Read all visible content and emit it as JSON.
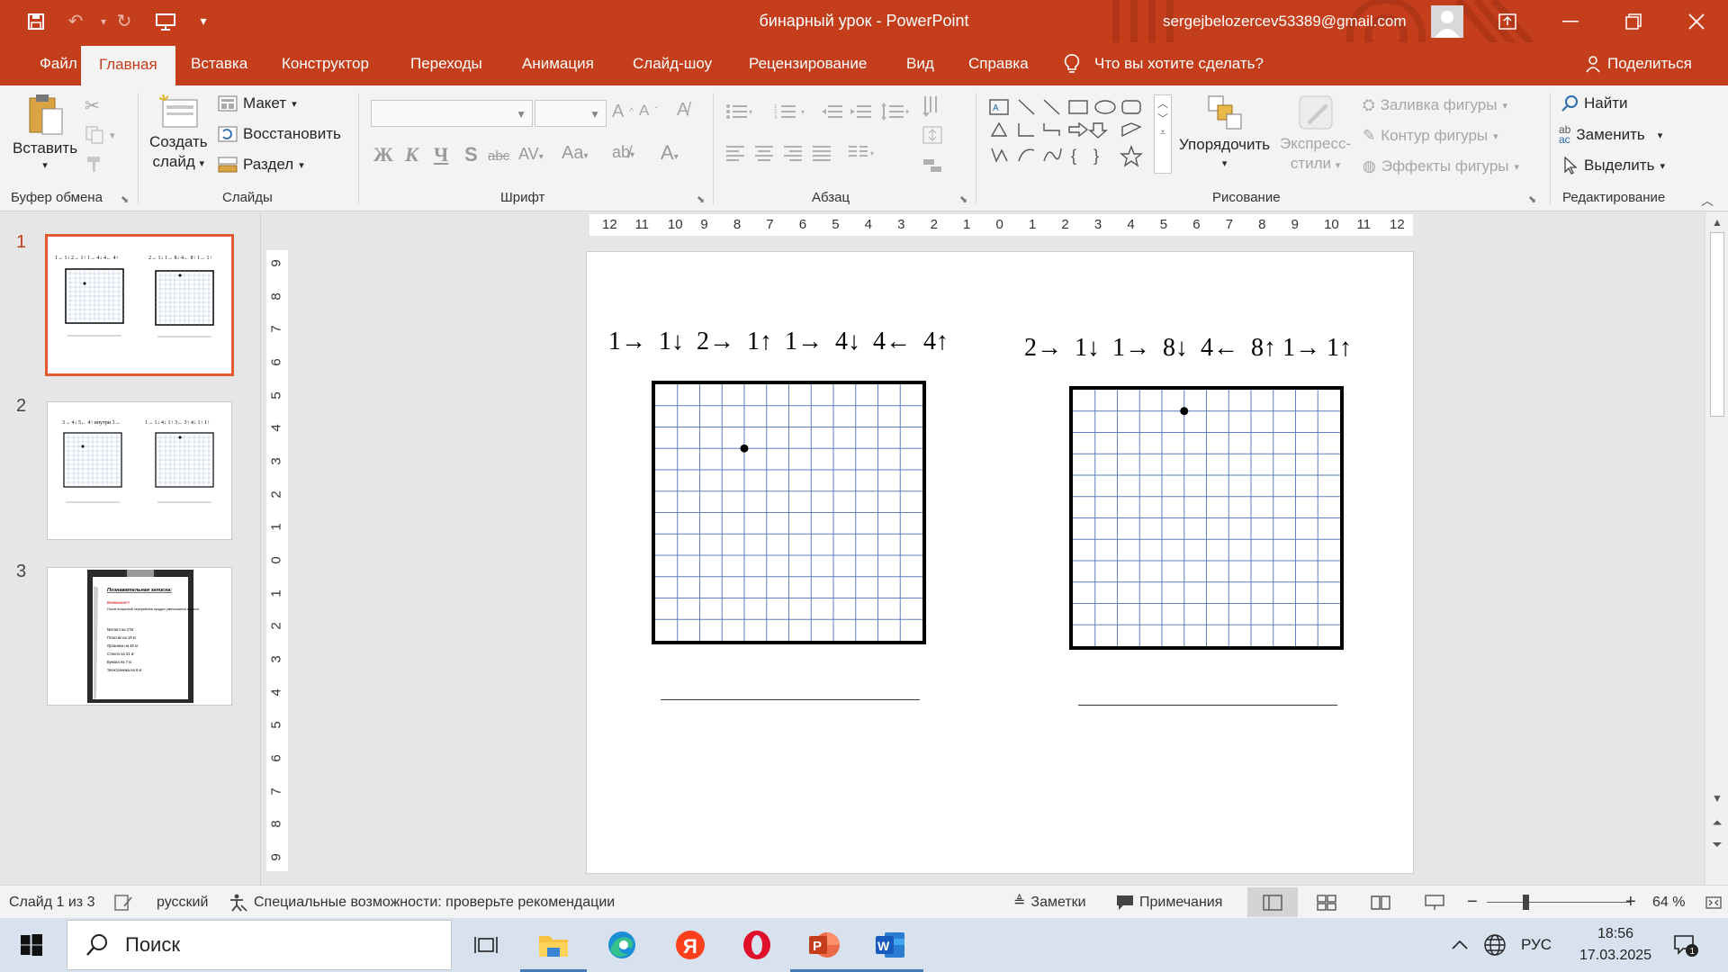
{
  "window": {
    "title": "бинарный урок  -  PowerPoint",
    "account_email": "sergejbelozercev53389@gmail.com"
  },
  "tabs": [
    {
      "label": "Файл"
    },
    {
      "label": "Главная"
    },
    {
      "label": "Вставка"
    },
    {
      "label": "Конструктор"
    },
    {
      "label": "Переходы"
    },
    {
      "label": "Анимация"
    },
    {
      "label": "Слайд-шоу"
    },
    {
      "label": "Рецензирование"
    },
    {
      "label": "Вид"
    },
    {
      "label": "Справка"
    }
  ],
  "tell_me": "Что вы хотите сделать?",
  "share_label": "Поделиться",
  "ribbon": {
    "clipboard": {
      "paste": "Вставить",
      "group": "Буфер обмена"
    },
    "slides": {
      "new_slide_line1": "Создать",
      "new_slide_line2": "слайд",
      "layout": "Макет",
      "reset": "Восстановить",
      "section": "Раздел",
      "group": "Слайды"
    },
    "font": {
      "group": "Шрифт",
      "bold": "Ж",
      "italic": "К",
      "underline": "Ч",
      "shadow": "S",
      "strike": "abc",
      "case": "Aa",
      "color": "A"
    },
    "paragraph": {
      "group": "Абзац"
    },
    "drawing": {
      "arrange": "Упорядочить",
      "styles_line1": "Экспресс-",
      "styles_line2": "стили",
      "fill": "Заливка фигуры",
      "outline": "Контур фигуры",
      "effects": "Эффекты фигуры",
      "group": "Рисование"
    },
    "editing": {
      "find": "Найти",
      "replace": "Заменить",
      "select": "Выделить",
      "group": "Редактирование"
    }
  },
  "slides_panel": [
    {
      "number": "1",
      "active": true
    },
    {
      "number": "2",
      "active": false
    },
    {
      "number": "3",
      "active": false
    }
  ],
  "thumb3": {
    "heading": "Познавательная записка:",
    "warn": "Внимание!!!",
    "intro": "После вторичной переработки продукт уменьшается в массе.",
    "items": [
      "Металл на 27кг",
      "Пластик на 19 кг",
      "Органика на 40 кг",
      "Стекло на 31 кг",
      "Бумага на 7 кг",
      "Электроника на 6 кг"
    ]
  },
  "ruler": {
    "horizontal": [
      "12",
      "11",
      "10",
      "9",
      "8",
      "7",
      "6",
      "5",
      "4",
      "3",
      "2",
      "1",
      "0",
      "1",
      "2",
      "3",
      "4",
      "5",
      "6",
      "7",
      "8",
      "9",
      "10",
      "11",
      "12"
    ],
    "vertical": [
      "9",
      "8",
      "7",
      "6",
      "5",
      "4",
      "3",
      "2",
      "1",
      "0",
      "1",
      "2",
      "3",
      "4",
      "5",
      "6",
      "7",
      "8",
      "9"
    ]
  },
  "slide": {
    "left_sequence": "1→  1↓  2→  1↑  1→  4↓  4←  4↑",
    "right_sequence": "2→  1↓  1→  8↓  4←  8↑ 1→ 1↑",
    "left_dot": {
      "col": 4,
      "row": 3
    },
    "right_dot": {
      "col": 5,
      "row": 1
    },
    "grid_cells": 12
  },
  "status": {
    "slide_info": "Слайд 1 из 3",
    "language": "русский",
    "accessibility": "Специальные возможности: проверьте рекомендации",
    "notes": "Заметки",
    "comments": "Примечания",
    "zoom_minus": "−",
    "zoom_plus": "+",
    "zoom": "64 %"
  },
  "taskbar": {
    "search": "Поиск",
    "lang": "РУС",
    "time": "18:56",
    "date": "17.03.2025",
    "notif_count": "1"
  },
  "colors": {
    "accent": "#c43e1c",
    "grid_line": "#5b7fc0",
    "selection": "#e3592f"
  }
}
